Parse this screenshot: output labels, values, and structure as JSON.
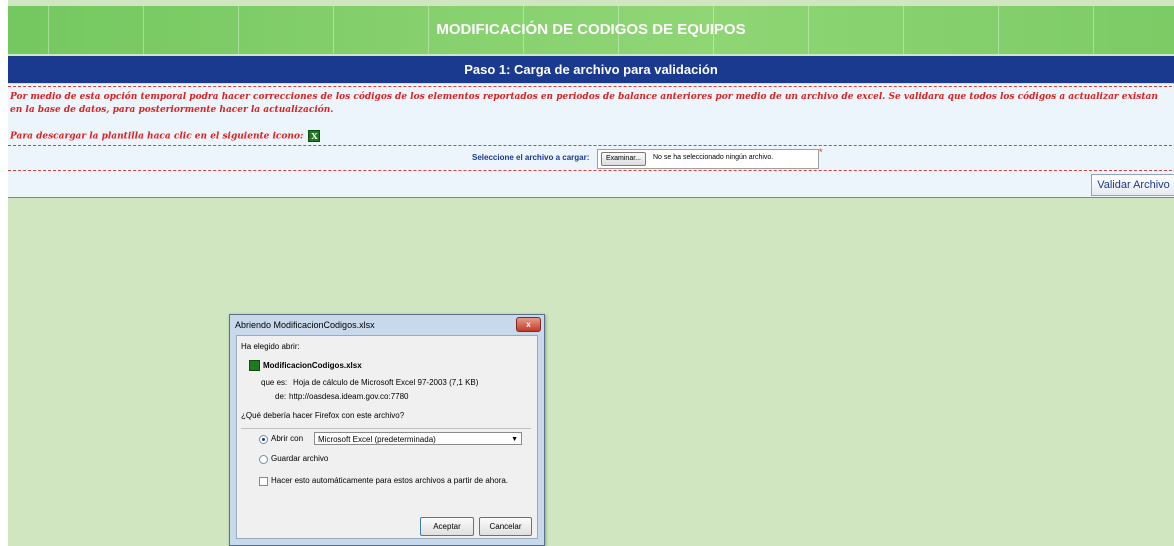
{
  "banner": {
    "title": "MODIFICACIÓN DE CODIGOS DE EQUIPOS"
  },
  "step": {
    "title": "Paso 1: Carga de archivo para validación"
  },
  "notice": {
    "paragraph": "Por medio de esta opción temporal podra hacer correcciones de los códigos de los elementos reportados en periodos de balance anteriores por medio de un archivo de excel. Se validara que todos los códigos a actualizar existan en la base de datos, para posteriormente hacer la actualización.",
    "download_text": "Para descargar la plantilla haca clic en el siguiente icono:"
  },
  "upload": {
    "label": "Seleccione el archivo a cargar:",
    "browse_label": "Examinar...",
    "status": "No se ha seleccionado ningún archivo.",
    "required_mark": "*"
  },
  "validate_button": "Validar Archivo",
  "dialog": {
    "title": "Abriendo ModificacionCodigos.xlsx",
    "close_label": "x",
    "chosen_label": "Ha elegido abrir:",
    "filename": "ModificacionCodigos.xlsx",
    "type_label": "que es:",
    "type_value": "Hoja de cálculo de Microsoft Excel 97-2003 (7,1 KB)",
    "from_label": "de:",
    "from_value": "http://oasdesa.ideam.gov.co:7780",
    "question": "¿Qué debería hacer Firefox con este archivo?",
    "open_with_label": "Abrir con",
    "open_with_value": "Microsoft Excel (predeterminada)",
    "save_label": "Guardar archivo",
    "auto_label": "Hacer esto automáticamente para estos archivos a partir de ahora.",
    "accept_label": "Aceptar",
    "cancel_label": "Cancelar"
  },
  "colors": {
    "banner": "#86d06e",
    "step_bar": "#1a3a8f",
    "notice_text": "#e02020",
    "background": "#d0e6c0"
  }
}
